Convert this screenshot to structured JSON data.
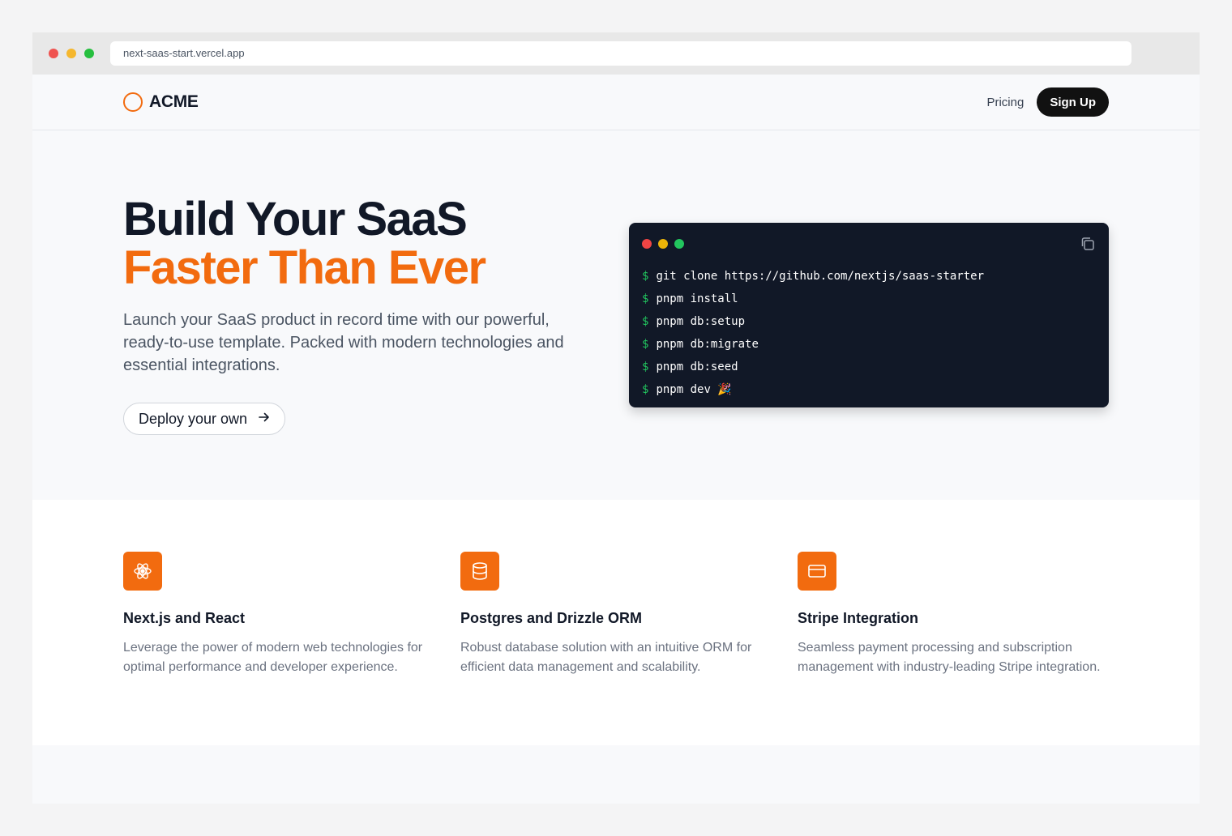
{
  "browser": {
    "url": "next-saas-start.vercel.app"
  },
  "nav": {
    "brand": "ACME",
    "pricing_label": "Pricing",
    "signup_label": "Sign Up"
  },
  "hero": {
    "title_line1": "Build Your SaaS",
    "title_line2": "Faster Than Ever",
    "description": "Launch your SaaS product in record time with our powerful, ready-to-use template. Packed with modern technologies and essential integrations.",
    "cta_label": "Deploy your own",
    "cta_icon": "arrow-right-icon"
  },
  "terminal": {
    "prompt": "$",
    "commands": [
      "git clone https://github.com/nextjs/saas-starter",
      "pnpm install",
      "pnpm db:setup",
      "pnpm db:migrate",
      "pnpm db:seed",
      "pnpm dev 🎉"
    ],
    "copy_icon": "copy-icon"
  },
  "features": [
    {
      "icon": "atom-icon",
      "title": "Next.js and React",
      "description": "Leverage the power of modern web technologies for optimal performance and developer experience."
    },
    {
      "icon": "database-icon",
      "title": "Postgres and Drizzle ORM",
      "description": "Robust database solution with an intuitive ORM for efficient data management and scalability."
    },
    {
      "icon": "credit-card-icon",
      "title": "Stripe Integration",
      "description": "Seamless payment processing and subscription management with industry-leading Stripe integration."
    }
  ],
  "colors": {
    "accent": "#f26b0f",
    "terminal_bg": "#111827",
    "prompt": "#22c55e"
  }
}
